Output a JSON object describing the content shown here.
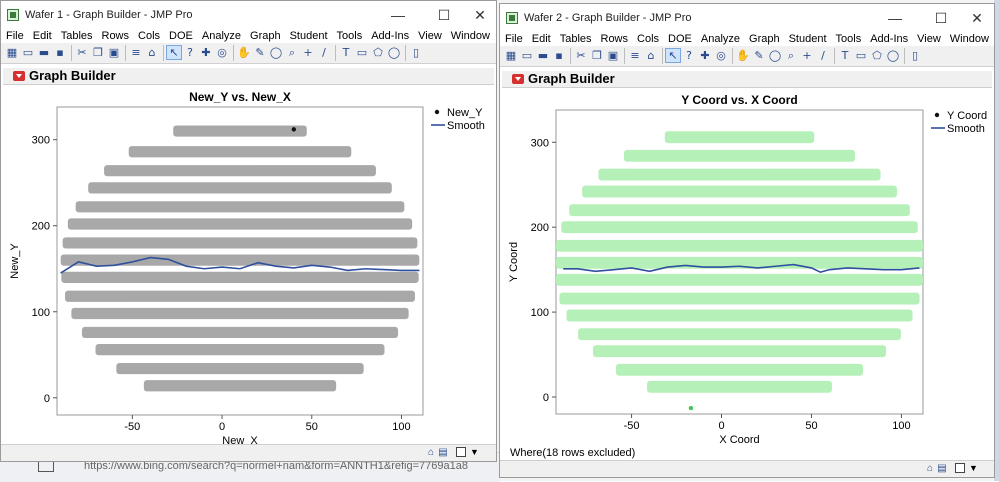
{
  "menu": [
    "File",
    "Edit",
    "Tables",
    "Rows",
    "Cols",
    "DOE",
    "Analyze",
    "Graph",
    "Student",
    "Tools",
    "Add-Ins",
    "View",
    "Window",
    "Help"
  ],
  "window_controls": {
    "minimize": "—",
    "maximize": "☐",
    "close": "✕"
  },
  "background": {
    "url_text": "https://www.bing.com/search?q=normel+nam&form=ANNTH1&refig=7769a1a8"
  },
  "left_window": {
    "title": "Wafer 1 - Graph Builder - JMP Pro",
    "panel_title": "Graph Builder",
    "chart_data": {
      "type": "scatter",
      "title": "New_Y vs. New_X",
      "xlabel": "New_X",
      "ylabel": "New_Y",
      "xlim": [
        -92,
        112
      ],
      "ylim": [
        -20,
        338
      ],
      "xticks": [
        -50,
        0,
        50,
        100
      ],
      "yticks": [
        0,
        100,
        200,
        300
      ],
      "grid": false,
      "legend": {
        "placement": "top-right",
        "entries": [
          "New_Y",
          "Smooth"
        ]
      },
      "point_color": "#a8a8a8",
      "smooth_color": "#2f4f9f",
      "wafer": {
        "center": [
          10,
          155
        ],
        "rx": 100,
        "ry": 167,
        "rows": [
          -12,
          14,
          34,
          56,
          76,
          98,
          118,
          140,
          160,
          180,
          202,
          222,
          244,
          264,
          286,
          310
        ],
        "row_thickness": 13
      },
      "outlier": [
        40,
        312
      ],
      "smooth": {
        "x": [
          -90,
          -80,
          -70,
          -60,
          -50,
          -40,
          -30,
          -20,
          -10,
          0,
          10,
          20,
          30,
          40,
          50,
          60,
          70,
          80,
          90,
          100,
          110
        ],
        "y": [
          145,
          158,
          153,
          154,
          158,
          163,
          161,
          153,
          150,
          152,
          150,
          157,
          153,
          151,
          154,
          152,
          148,
          150,
          149,
          148,
          148
        ]
      }
    }
  },
  "right_window": {
    "title": "Wafer 2 - Graph Builder - JMP Pro",
    "panel_title": "Graph Builder",
    "where": "Where(18 rows excluded)",
    "chart_data": {
      "type": "scatter",
      "title": "Y Coord vs. X Coord",
      "xlabel": "X Coord",
      "ylabel": "Y Coord",
      "xlim": [
        -92,
        112
      ],
      "ylim": [
        -20,
        338
      ],
      "xticks": [
        -50,
        0,
        50,
        100
      ],
      "yticks": [
        0,
        100,
        200,
        300
      ],
      "grid": false,
      "legend": {
        "placement": "top-right",
        "entries": [
          "Y Coord",
          "Smooth"
        ]
      },
      "point_color": "#b6f0b9",
      "smooth_color": "#2f4f9f",
      "wafer": {
        "center": [
          10,
          155
        ],
        "rx": 103,
        "ry": 165,
        "rows": [
          -10,
          12,
          32,
          54,
          74,
          96,
          116,
          138,
          158,
          178,
          200,
          220,
          242,
          262,
          284,
          306
        ],
        "row_thickness": 14
      },
      "outlier": [
        -17,
        -13
      ],
      "smooth": {
        "x": [
          -88,
          -80,
          -70,
          -60,
          -50,
          -40,
          -30,
          -20,
          -10,
          0,
          10,
          20,
          30,
          40,
          50,
          55,
          60,
          70,
          80,
          90,
          100,
          110
        ],
        "y": [
          151,
          151,
          148,
          150,
          152,
          148,
          153,
          155,
          153,
          153,
          154,
          152,
          154,
          156,
          152,
          147,
          150,
          152,
          151,
          150,
          150,
          152
        ]
      }
    }
  }
}
